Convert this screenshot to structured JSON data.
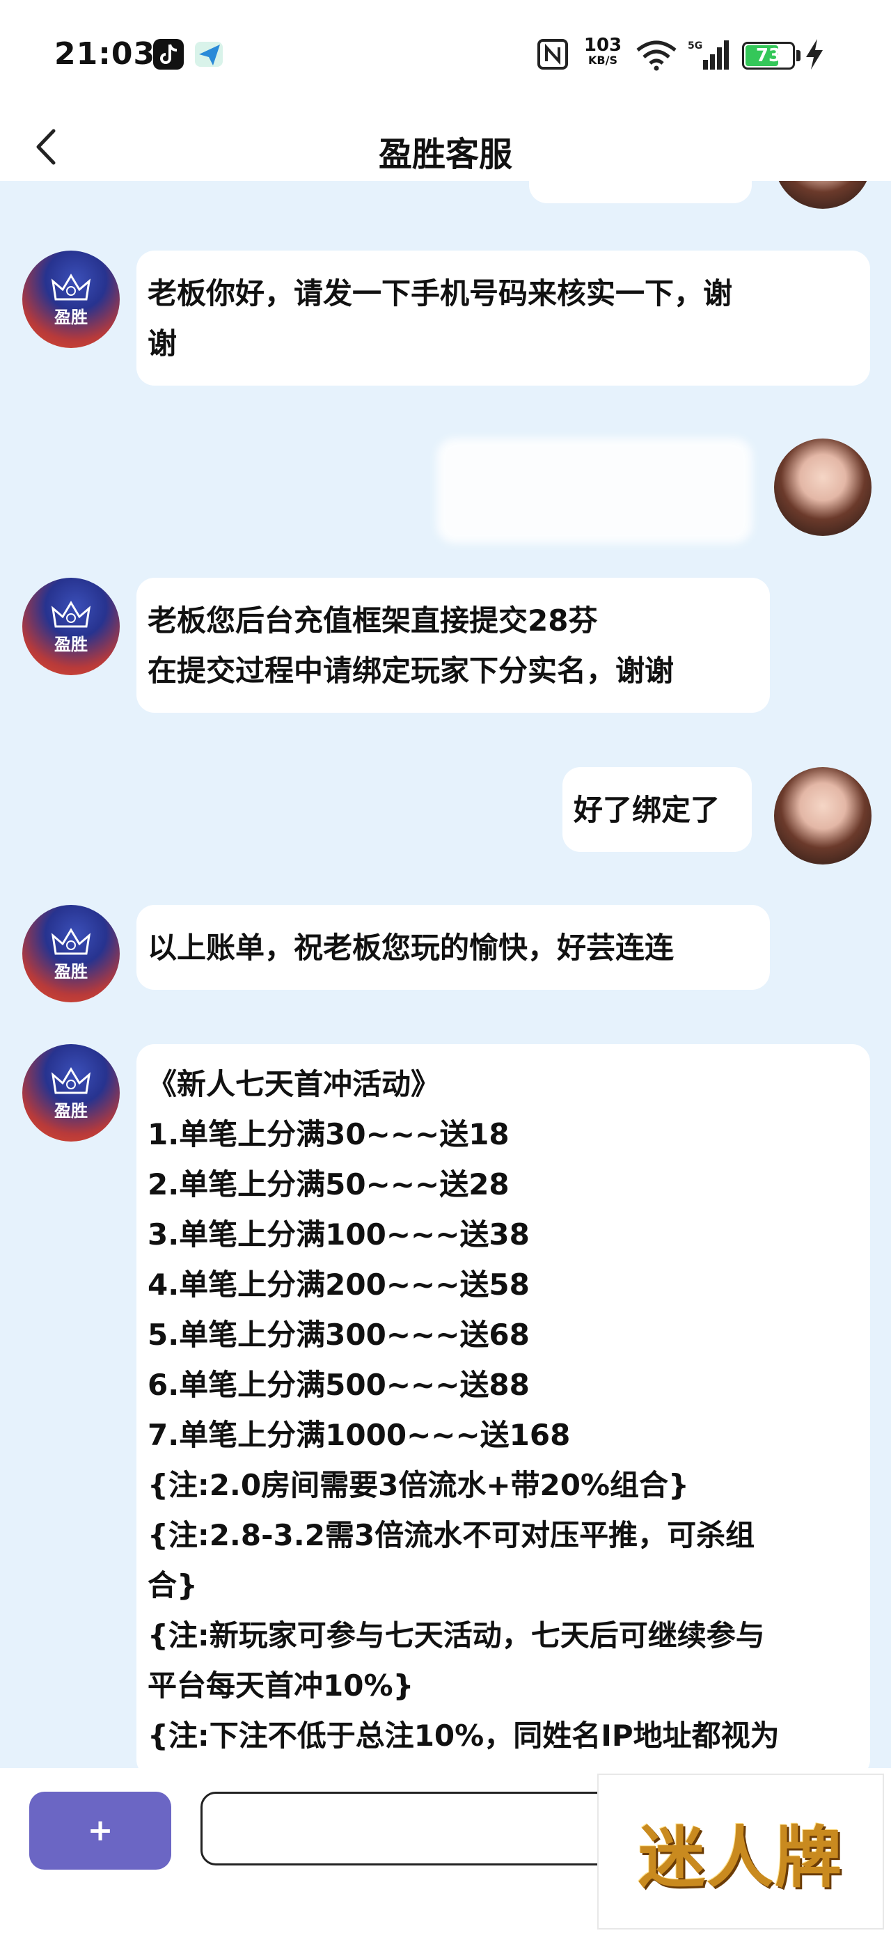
{
  "status_bar": {
    "time": "21:03",
    "speed_value": "103",
    "speed_unit": "KB/S",
    "network": "5G",
    "battery": "73",
    "battery_level_percent": 73,
    "icons": [
      "tiktok-icon",
      "app-arrow-icon",
      "nfc-icon",
      "wifi-icon",
      "signal-icon",
      "battery-icon",
      "charging-bolt-icon"
    ]
  },
  "header": {
    "title": "盈胜客服",
    "back_icon": "chevron-left-icon"
  },
  "brand_avatar_label": "盈胜",
  "messages": [
    {
      "sender": "agent",
      "text": "老板你好，请发一下手机号码来核实一下，谢\n谢"
    },
    {
      "sender": "user",
      "text": ""
    },
    {
      "sender": "agent",
      "text": "老板您后台充值框架直接提交28芬\n在提交过程中请绑定玩家下分实名，谢谢"
    },
    {
      "sender": "user",
      "text": "好了绑定了"
    },
    {
      "sender": "agent",
      "text": "以上账单，祝老板您玩的愉快，好芸连连"
    },
    {
      "sender": "agent",
      "text": "《新人七天首冲活动》\n1.单笔上分满30~~~送18\n2.单笔上分满50~~~送28\n3.单笔上分满100~~~送38\n4.单笔上分满200~~~送58\n5.单笔上分满300~~~送68\n6.单笔上分满500~~~送88\n7.单笔上分满1000~~~送168\n{注:2.0房间需要3倍流水+带20%组合}\n{注:2.8-3.2需3倍流水不可对压平推，可杀组\n合}\n{注:新玩家可参与七天活动，七天后可继续参与\n平台每天首冲10%}\n{注:下注不低于总注10%，同姓名IP地址都视为"
    }
  ],
  "bottom_bar": {
    "plus_label": "+",
    "input_value": "",
    "input_placeholder": ""
  },
  "watermark": {
    "text": "迷人牌"
  },
  "colors": {
    "background": "#e6f2fc",
    "bubble": "#ffffff",
    "plus_button": "#6b66c4",
    "battery_green": "#34c759",
    "watermark_gold": "#c98a1f"
  }
}
